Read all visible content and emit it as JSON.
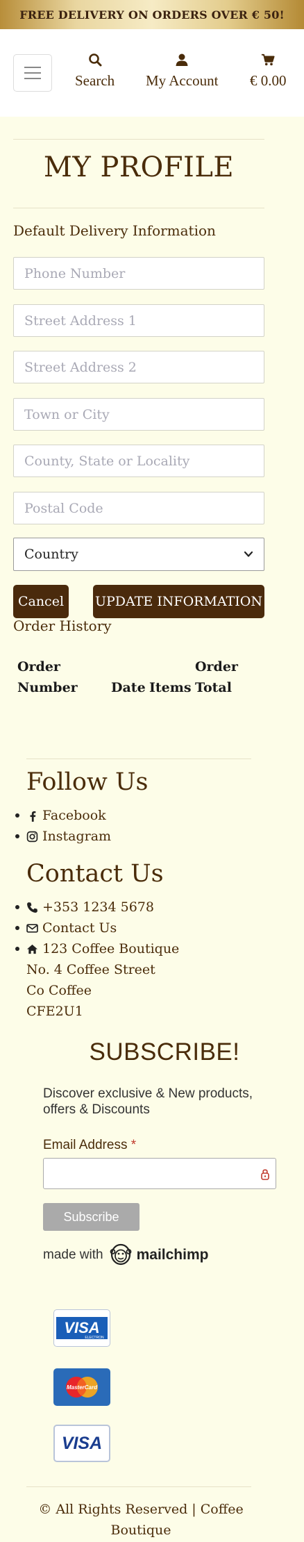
{
  "banner": {
    "text": "FREE DELIVERY ON ORDERS OVER € 50!"
  },
  "header": {
    "search_label": "Search",
    "account_label": "My Account",
    "cart_total": "€ 0.00"
  },
  "profile": {
    "title": "MY PROFILE",
    "section_label": "Default Delivery Information",
    "fields": [
      {
        "placeholder": "Phone Number"
      },
      {
        "placeholder": "Street Address 1"
      },
      {
        "placeholder": "Street Address 2"
      },
      {
        "placeholder": "Town or City"
      },
      {
        "placeholder": "County, State or Locality"
      },
      {
        "placeholder": "Postal Code"
      }
    ],
    "country_label": "Country",
    "cancel_label": "Cancel",
    "update_label": "UPDATE INFORMATION"
  },
  "order_history": {
    "title": "Order History",
    "col_order_number_1": "Order",
    "col_order_number_2": "Number",
    "col_date": "Date",
    "col_items": "Items",
    "col_total_1": "Order",
    "col_total_2": "Total"
  },
  "footer": {
    "follow_title": "Follow Us",
    "facebook": "Facebook",
    "instagram": "Instagram",
    "contact_title": "Contact Us",
    "phone": "+353 1234 5678",
    "contact_link": "Contact Us",
    "address_line1": "123 Coffee Boutique",
    "address_line2": "No. 4 Coffee Street",
    "address_line3": "Co Coffee",
    "address_line4": "CFE2U1",
    "copyright_line1": "© All Rights Reserved | Coffee",
    "copyright_line2": "Boutique"
  },
  "subscribe": {
    "title": "SUBSCRIBE!",
    "description": "Discover exclusive & New products, offers & Discounts",
    "email_label": "Email Address",
    "required_mark": "*",
    "button_label": "Subscribe",
    "made_with": "made with",
    "brand": "mailchimp"
  },
  "payment_cards": [
    {
      "name": "visa-electron-card",
      "text": "VISA",
      "sub": "ELECTRON"
    },
    {
      "name": "mastercard-card",
      "text": "MasterCard"
    },
    {
      "name": "visa-card",
      "text": "VISA"
    }
  ],
  "colors": {
    "brand_brown": "#4a2a0c",
    "page_background": "#fdfde8",
    "required_red": "#c0392b"
  }
}
